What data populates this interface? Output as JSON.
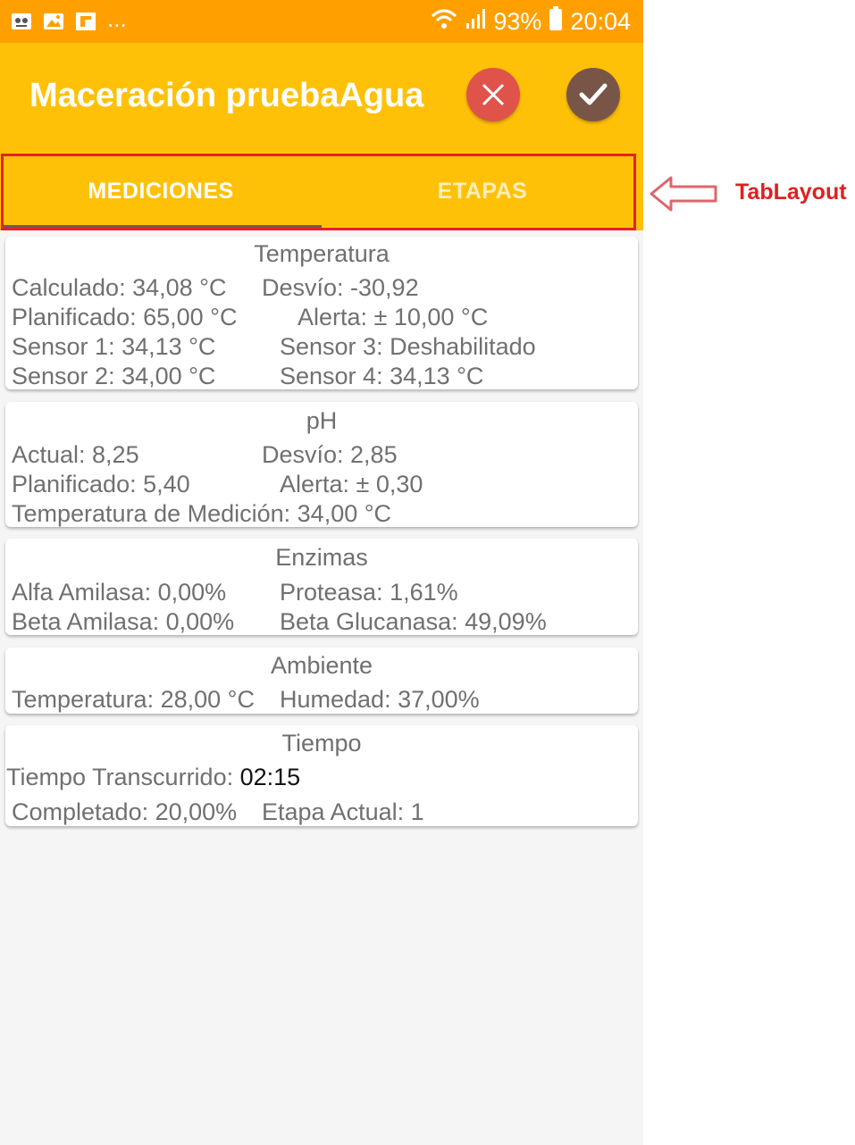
{
  "status_bar": {
    "battery": "93%",
    "time": "20:04",
    "more": "...",
    "icons": [
      "app-icon",
      "gallery-icon",
      "flipboard-icon",
      "wifi-icon",
      "signal-icon",
      "battery-icon"
    ]
  },
  "app_bar": {
    "title": "Maceración pruebaAgua",
    "cancel_icon": "close-icon",
    "confirm_icon": "check-icon",
    "colors": {
      "status": "#ffa000",
      "bar": "#ffc107",
      "cancel": "#e0534a",
      "confirm": "#795548"
    }
  },
  "tabs": [
    {
      "label": "MEDICIONES",
      "selected": true
    },
    {
      "label": "ETAPAS",
      "selected": false
    }
  ],
  "annotation": {
    "label": "TabLayout",
    "color": "#e8202a"
  },
  "cards": {
    "temperatura": {
      "title": "Temperatura",
      "calculado": "Calculado: 34,08 °C",
      "desvio": "Desvío: -30,92",
      "planificado": "Planificado: 65,00 °C",
      "alerta": "Alerta: ± 10,00 °C",
      "sensor1": "Sensor 1: 34,13 °C",
      "sensor3": "Sensor 3: Deshabilitado",
      "sensor2": "Sensor 2: 34,00 °C",
      "sensor4": "Sensor 4: 34,13 °C"
    },
    "ph": {
      "title": "pH",
      "actual": "Actual: 8,25",
      "desvio": "Desvío: 2,85",
      "planificado": "Planificado: 5,40",
      "alerta": "Alerta: ± 0,30",
      "temp_medicion": "Temperatura de Medición: 34,00 °C"
    },
    "enzimas": {
      "title": "Enzimas",
      "alfa": "Alfa Amilasa: 0,00%",
      "proteasa": "Proteasa: 1,61%",
      "beta": "Beta Amilasa: 0,00%",
      "beta_glucanasa": "Beta Glucanasa: 49,09%"
    },
    "ambiente": {
      "title": "Ambiente",
      "temperatura": "Temperatura: 28,00 °C",
      "humedad": "Humedad: 37,00%"
    },
    "tiempo": {
      "title": "Tiempo",
      "transcurrido_label": "Tiempo Transcurrido:",
      "transcurrido_value": "02:15",
      "completado": "Completado: 20,00%",
      "etapa": "Etapa Actual: 1"
    }
  }
}
